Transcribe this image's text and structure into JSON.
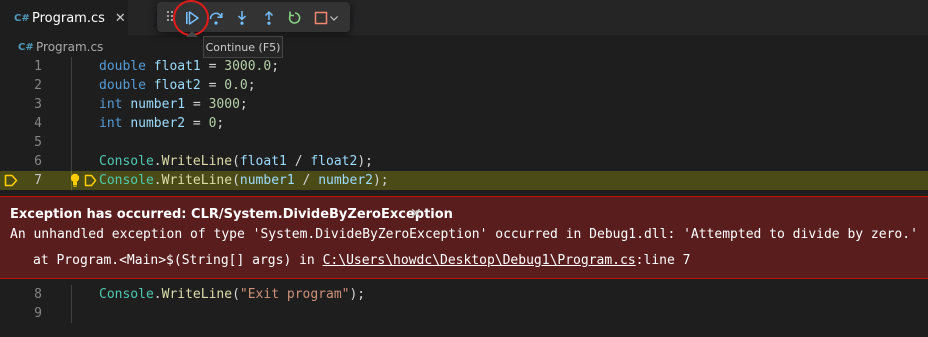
{
  "tab": {
    "icon": "csharp-file-icon",
    "icon_text": "C#",
    "label": "Program.cs",
    "close": "✕"
  },
  "debug_toolbar": {
    "buttons": [
      "drag-grip",
      "continue",
      "step-over",
      "step-into",
      "step-out",
      "restart",
      "stop"
    ],
    "accent": "#75beff",
    "restart_color": "#89d185",
    "stop_color": "#f48771",
    "highlight_color": "#e51a1a"
  },
  "tooltip": {
    "text": "Continue (F5)"
  },
  "breadcrumb": {
    "icon_text": "C#",
    "label": "Program.cs"
  },
  "code_top": [
    {
      "num": "1",
      "code": [
        [
          "k",
          "double "
        ],
        [
          "v",
          "float1"
        ],
        [
          "p",
          " = "
        ],
        [
          "n",
          "3000.0"
        ],
        [
          "p",
          ";"
        ]
      ]
    },
    {
      "num": "2",
      "code": [
        [
          "k",
          "double "
        ],
        [
          "v",
          "float2"
        ],
        [
          "p",
          " = "
        ],
        [
          "n",
          "0.0"
        ],
        [
          "p",
          ";"
        ]
      ]
    },
    {
      "num": "3",
      "code": [
        [
          "k",
          "int "
        ],
        [
          "v",
          "number1"
        ],
        [
          "p",
          " = "
        ],
        [
          "n",
          "3000"
        ],
        [
          "p",
          ";"
        ]
      ]
    },
    {
      "num": "4",
      "code": [
        [
          "k",
          "int "
        ],
        [
          "v",
          "number2"
        ],
        [
          "p",
          " = "
        ],
        [
          "n",
          "0"
        ],
        [
          "p",
          ";"
        ]
      ]
    },
    {
      "num": "5",
      "code": []
    },
    {
      "num": "6",
      "code": [
        [
          "t",
          "Console"
        ],
        [
          "p",
          "."
        ],
        [
          "f",
          "WriteLine"
        ],
        [
          "p",
          "("
        ],
        [
          "v",
          "float1"
        ],
        [
          "p",
          " / "
        ],
        [
          "v",
          "float2"
        ],
        [
          "p",
          ");"
        ]
      ]
    },
    {
      "num": "7",
      "current": true,
      "code": [
        [
          "t",
          "Console"
        ],
        [
          "p",
          "."
        ],
        [
          "f",
          "WriteLine"
        ],
        [
          "p",
          "("
        ],
        [
          "v",
          "number1"
        ],
        [
          "p",
          " / "
        ],
        [
          "v",
          "number2"
        ],
        [
          "p",
          ");"
        ]
      ]
    }
  ],
  "exception": {
    "title": "Exception has occurred: CLR/System.DivideByZeroException",
    "close": "✕",
    "message": "An unhandled exception of type 'System.DivideByZeroException' occurred in Debug1.dll: 'Attempted to divide by zero.'",
    "stack_prefix": "at Program.<Main>$(String[] args) in ",
    "stack_link": "C:\\Users\\howdc\\Desktop\\Debug1\\Program.cs",
    "stack_suffix": ":line 7"
  },
  "code_bottom": [
    {
      "num": "8",
      "code": [
        [
          "t",
          "Console"
        ],
        [
          "p",
          "."
        ],
        [
          "f",
          "WriteLine"
        ],
        [
          "p",
          "("
        ],
        [
          "s",
          "\"Exit program\""
        ],
        [
          "p",
          ");"
        ]
      ]
    },
    {
      "num": "9",
      "code": []
    }
  ]
}
